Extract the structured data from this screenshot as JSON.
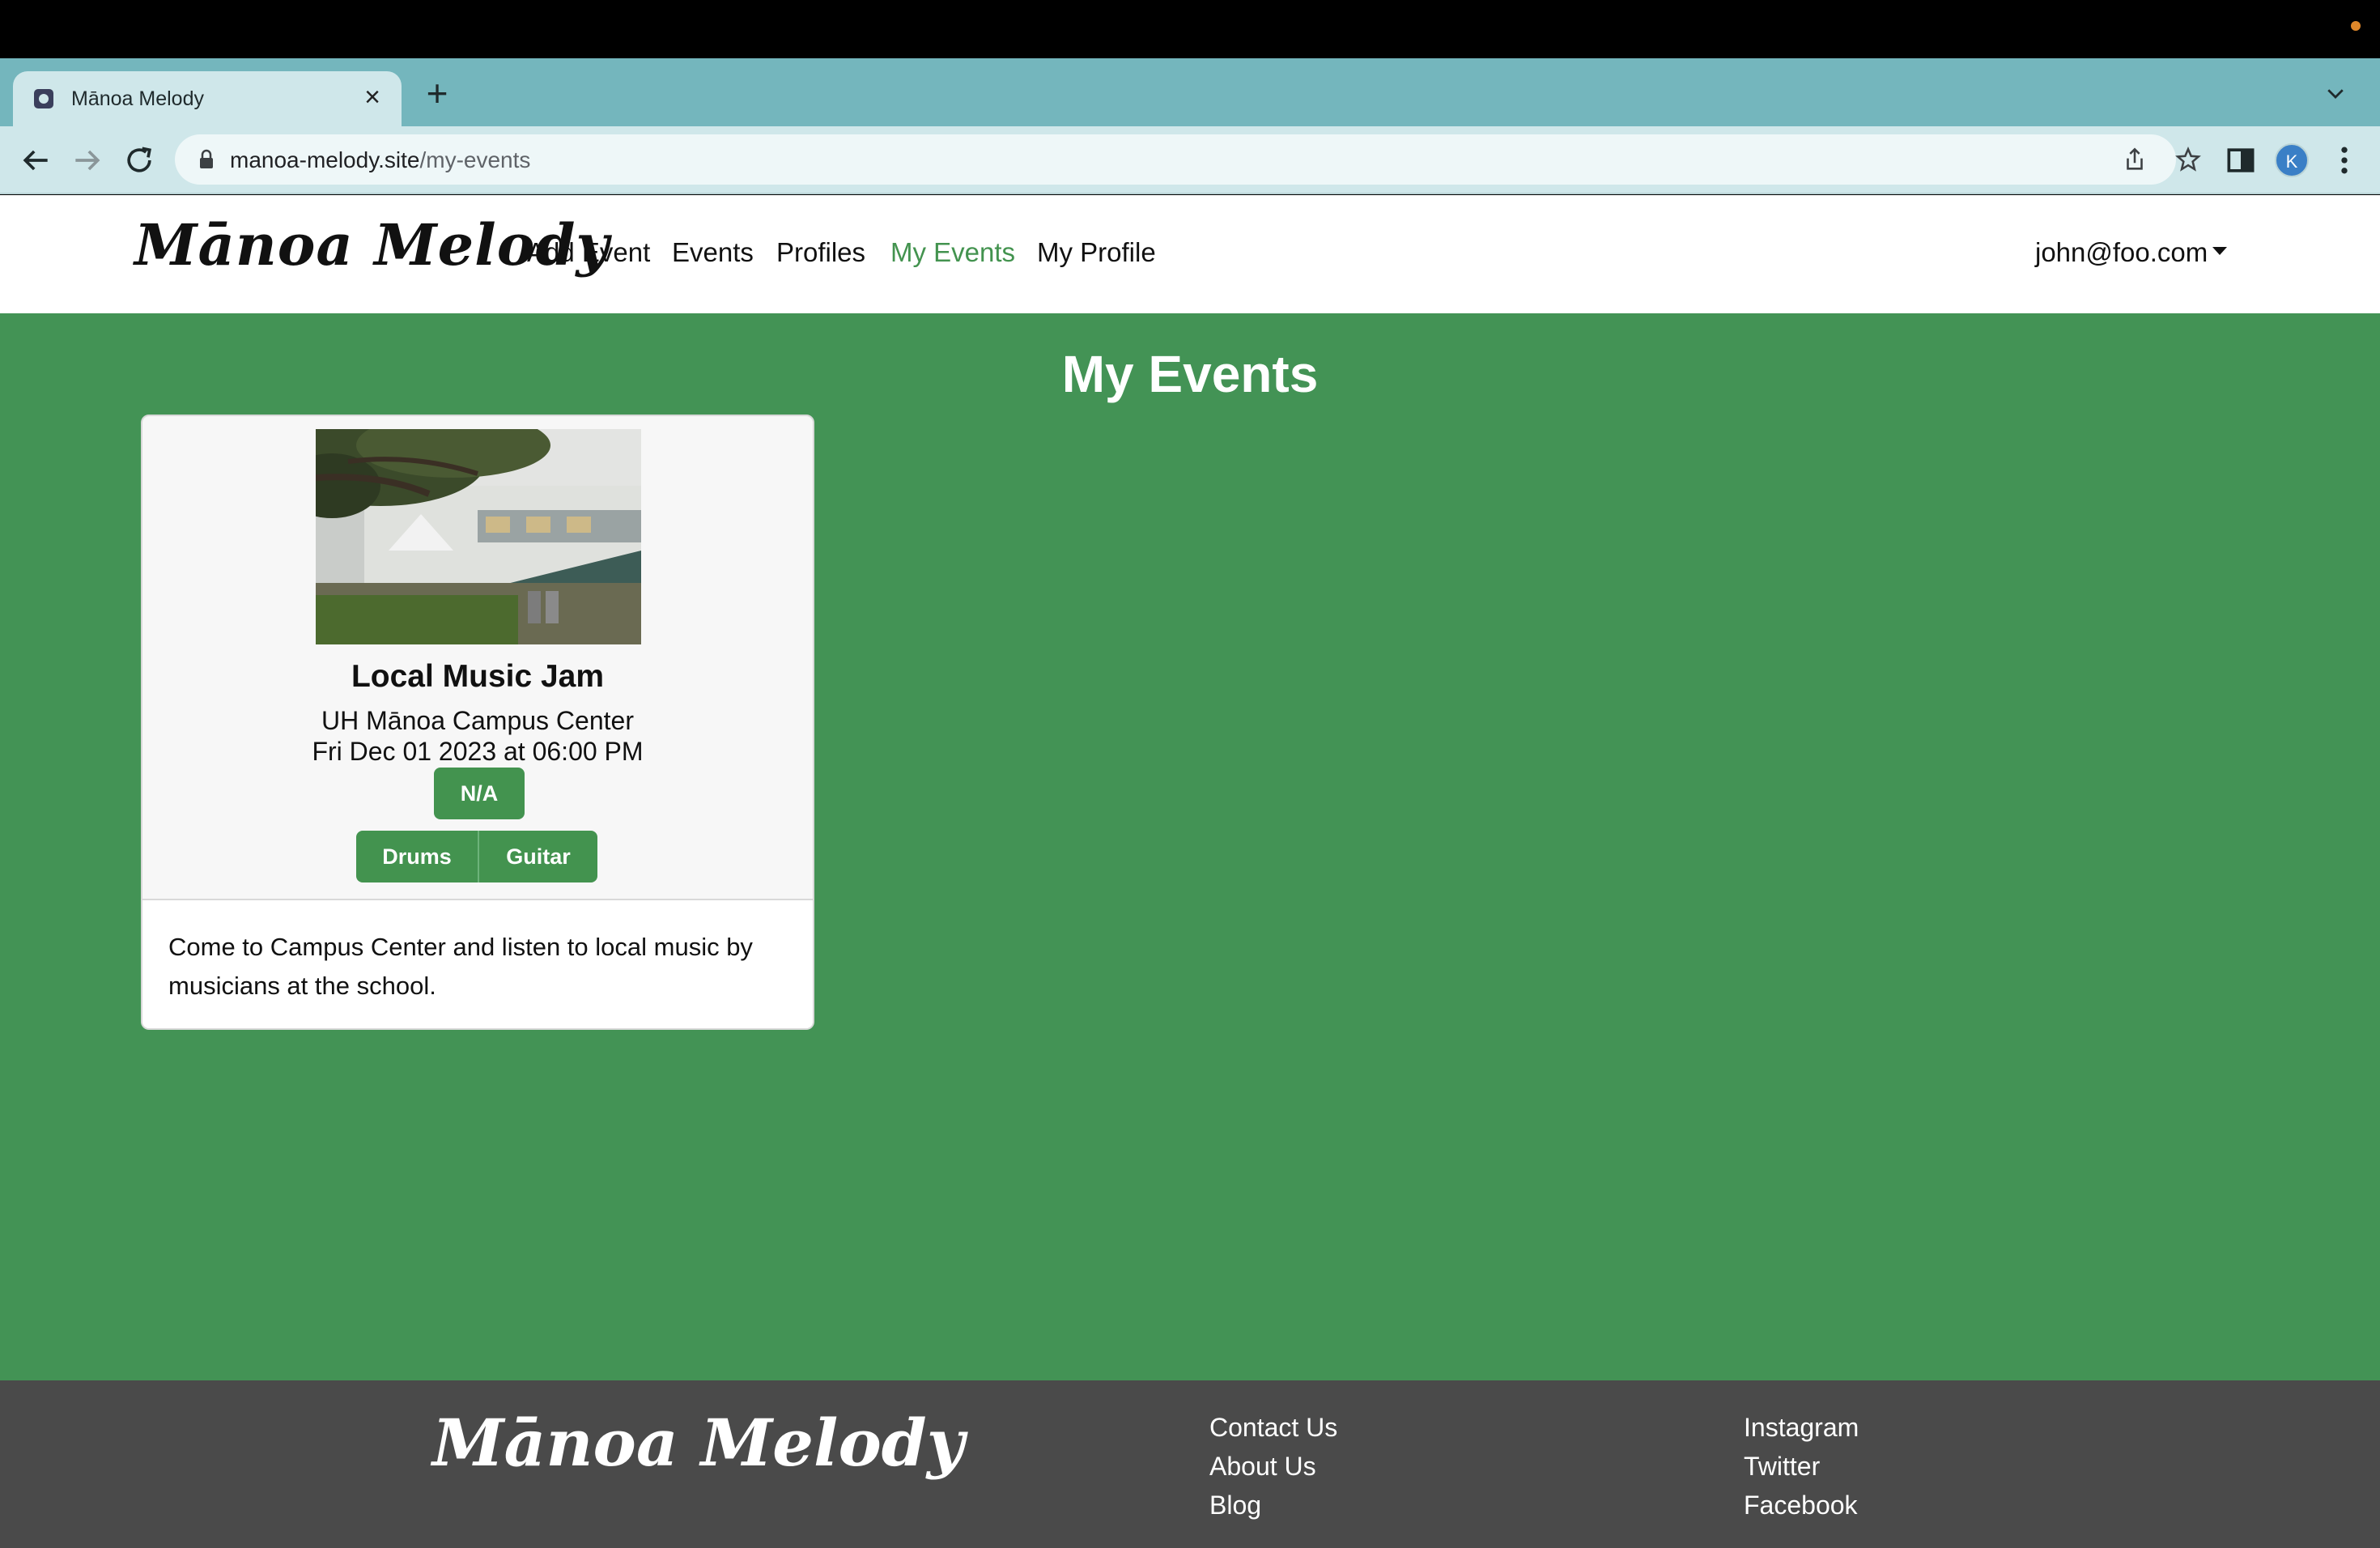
{
  "browser": {
    "tab_title": "Mānoa Melody",
    "url_host": "manoa-melody.site",
    "url_path": "/my-events",
    "avatar_letter": "K",
    "accent": "#74b6bd"
  },
  "navbar": {
    "brand": "Mānoa Melody",
    "links": [
      {
        "label": "Add Event",
        "active": false
      },
      {
        "label": "Events",
        "active": false
      },
      {
        "label": "Profiles",
        "active": false
      },
      {
        "label": "My Events",
        "active": true
      },
      {
        "label": "My Profile",
        "active": false
      }
    ],
    "user": "john@foo.com"
  },
  "main": {
    "title": "My Events",
    "background": "#439355",
    "events": [
      {
        "image_icon": "campus-center-photo",
        "title": "Local Music Jam",
        "location": "UH Mānoa Campus Center",
        "datetime": "Fri Dec 01 2023 at 06:00 PM",
        "badge": "N/A",
        "instruments": [
          "Drums",
          "Guitar"
        ],
        "description": "Come to Campus Center and listen to local music by musicians at the school."
      }
    ]
  },
  "footer": {
    "brand": "Mānoa Melody",
    "col1": [
      "Contact Us",
      "About Us",
      "Blog"
    ],
    "col2": [
      "Instagram",
      "Twitter",
      "Facebook"
    ]
  }
}
